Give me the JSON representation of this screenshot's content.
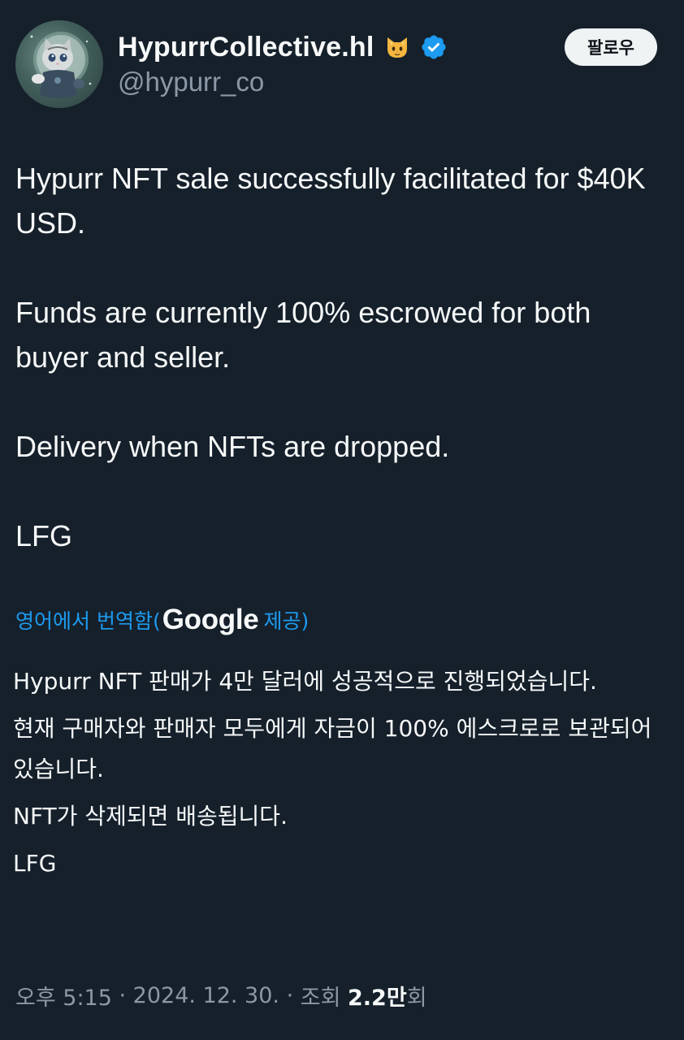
{
  "author": {
    "display_name": "HypurrCollective.hl",
    "handle": "@hypurr_co",
    "name_emoji": "cat-face-icon",
    "verified": true
  },
  "follow_button": {
    "label": "팔로우"
  },
  "tweet": {
    "paragraphs": [
      "Hypurr NFT sale successfully facilitated for $40K USD.",
      "Funds are currently 100% escrowed for both buyer and seller.",
      "Delivery when NFTs are dropped.",
      "LFG"
    ]
  },
  "translation": {
    "link_label": "영어에서 번역함(",
    "provider": "Google",
    "provider_suffix": " 제공)",
    "paragraphs": [
      "Hypurr NFT 판매가 4만 달러에 성공적으로 진행되었습니다.",
      "현재 구매자와 판매자 모두에게 자금이 100% 에스크로로 보관되어 있습니다.",
      "NFT가 삭제되면 배송됩니다.",
      "LFG"
    ]
  },
  "meta": {
    "time": "오후 5:15",
    "separator": " · ",
    "date": "2024. 12. 30.",
    "views_label": "조회 ",
    "views_count": "2.2만",
    "views_suffix": "회"
  },
  "colors": {
    "background": "#15202b",
    "text": "#f7f9f9",
    "secondary": "#8b98a5",
    "accent": "#1d9bf0",
    "verified": "#1d9bf0"
  }
}
